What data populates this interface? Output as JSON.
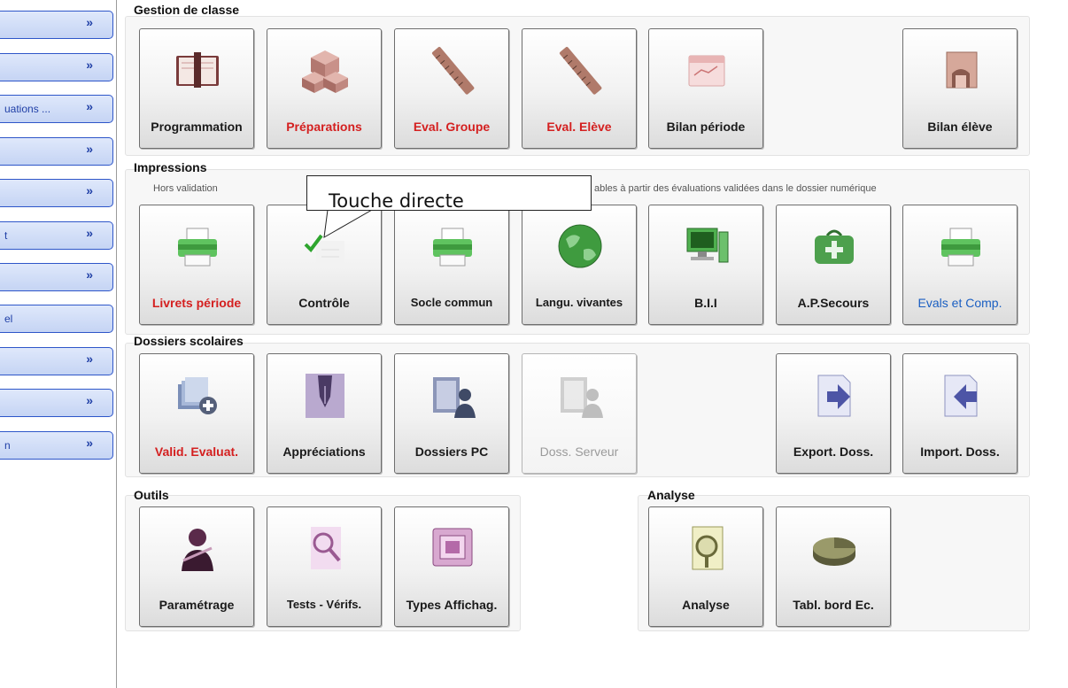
{
  "sidebar": {
    "items": [
      {
        "label": "",
        "chev": "»"
      },
      {
        "label": "",
        "chev": "»"
      },
      {
        "label": "uations ...",
        "chev": "»"
      },
      {
        "label": "",
        "chev": "»"
      },
      {
        "label": "",
        "chev": "»"
      },
      {
        "label": "t",
        "chev": "»"
      },
      {
        "label": "",
        "chev": "»"
      },
      {
        "label": "el",
        "chev": ""
      },
      {
        "label": "",
        "chev": "»"
      },
      {
        "label": "",
        "chev": "»"
      },
      {
        "label": "n",
        "chev": "»"
      }
    ]
  },
  "sections": {
    "gestion": {
      "title": "Gestion de classe"
    },
    "impressions": {
      "title": "Impressions",
      "note_left": "Hors validation",
      "note_right": "ables à partir des évaluations validées dans le dossier numérique"
    },
    "dossiers": {
      "title": "Dossiers scolaires"
    },
    "outils": {
      "title": "Outils"
    },
    "analyse": {
      "title": "Analyse"
    }
  },
  "buttons": {
    "programmation": "Programmation",
    "preparations": "Préparations",
    "eval_groupe": "Eval. Groupe",
    "eval_eleve": "Eval. Elève",
    "bilan_periode": "Bilan période",
    "bilan_eleve": "Bilan élève",
    "livrets_periode": "Livrets période",
    "controle": "Contrôle",
    "socle_commun": "Socle commun",
    "langu_vivantes": "Langu. vivantes",
    "bii": "B.I.I",
    "ap_secours": "A.P.Secours",
    "evals_comp": "Evals et Comp.",
    "valid_evaluat": "Valid. Evaluat.",
    "appreciations": "Appréciations",
    "dossiers_pc": "Dossiers PC",
    "doss_serveur": "Doss. Serveur",
    "export_doss": "Export. Doss.",
    "import_doss": "Import. Doss.",
    "parametrage": "Paramétrage",
    "tests_verifs": "Tests - Vérifs.",
    "types_affichag": "Types Affichag.",
    "analyse": "Analyse",
    "tabl_bord": "Tabl. bord Ec."
  },
  "callout": {
    "text": "Touche directe"
  },
  "colors": {
    "accent_red": "#d42020",
    "accent_blue": "#1b5fc2",
    "sidebar_border": "#2e56c9"
  }
}
